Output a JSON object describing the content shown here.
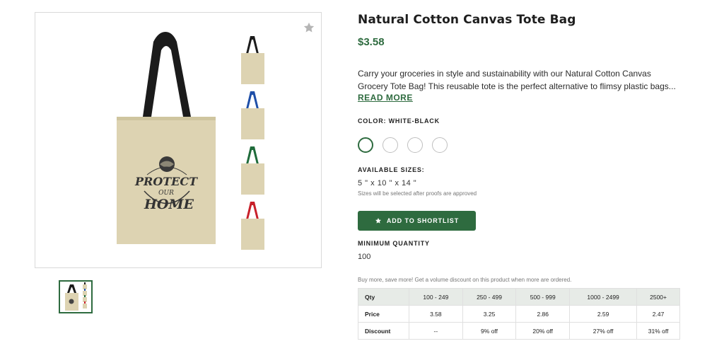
{
  "gallery": {
    "favorite_icon": "star-icon",
    "hero_strap_color": "#1b1b1b",
    "bag_color": "#ddd3b2",
    "print_text": [
      "PROTECT",
      "OUR",
      "HOME"
    ],
    "colorway_straps": [
      "#1b1b1b",
      "#1f4fa8",
      "#1f6b3a",
      "#c8202a"
    ]
  },
  "product": {
    "title": "Natural Cotton Canvas Tote Bag",
    "price": "$3.58",
    "description_lines": [
      "Carry your groceries in style and sustainability with our Natural Cotton Canvas",
      "Grocery Tote Bag! This reusable tote is the perfect alternative to flimsy plastic bags..."
    ],
    "read_more": "READ MORE",
    "color_label": "COLOR: WHITE-BLACK",
    "available_sizes_label": "AVAILABLE SIZES:",
    "sizes_value": "5 \" x 10 \" x 14 \"",
    "sizes_note": "Sizes will be selected after proofs are approved",
    "shortlist_button": "ADD TO SHORTLIST",
    "shortlist_icon": "star-icon",
    "minimum_quantity_label": "MINIMUM QUANTITY",
    "minimum_quantity": "100",
    "volume_note": "Buy more, save more! Get a volume discount on this product when more are ordered."
  },
  "pricing": {
    "headers": [
      "Qty",
      "100 - 249",
      "250 - 499",
      "500 - 999",
      "1000 - 2499",
      "2500+"
    ],
    "price_row": [
      "Price",
      "3.58",
      "3.25",
      "2.86",
      "2.59",
      "2.47"
    ],
    "discount_row": [
      "Discount",
      "--",
      "9% off",
      "20% off",
      "27% off",
      "31% off"
    ]
  },
  "colors": {
    "accent": "#2e6b3f",
    "table_header_bg": "#e7ebe7"
  }
}
